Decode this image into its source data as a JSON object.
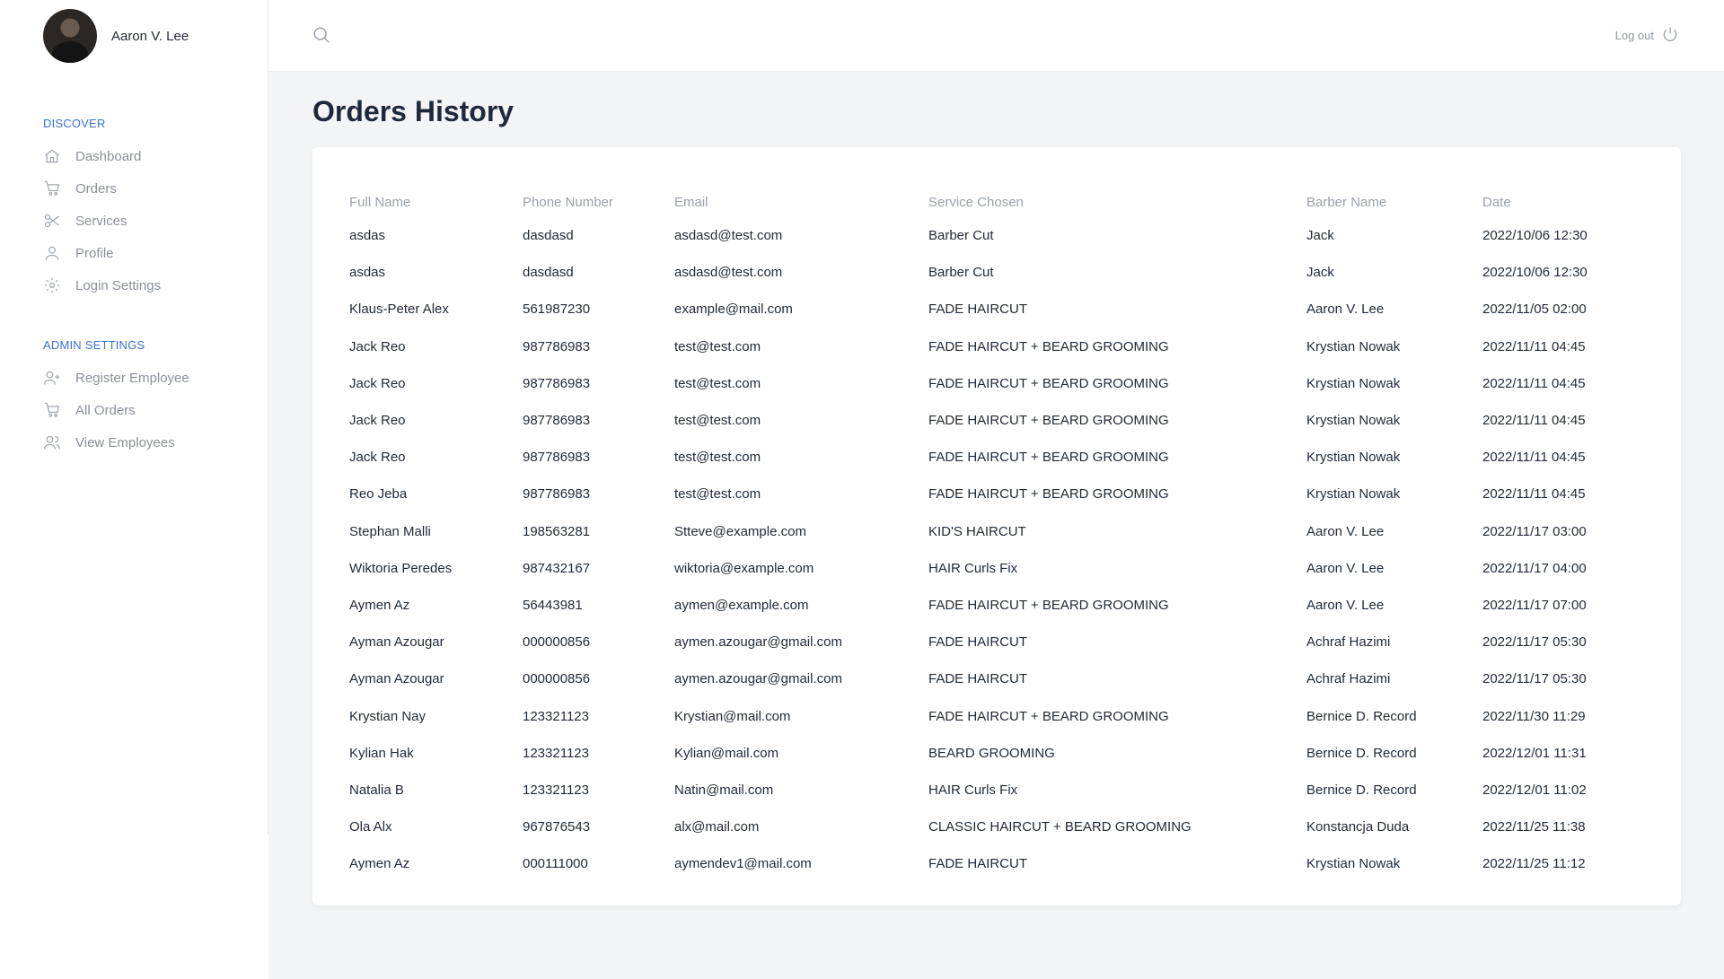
{
  "user": {
    "name": "Aaron V. Lee"
  },
  "sidebar": {
    "discover_title": "DISCOVER",
    "discover_items": [
      {
        "label": "Dashboard",
        "icon": "home-icon"
      },
      {
        "label": "Orders",
        "icon": "cart-icon"
      },
      {
        "label": "Services",
        "icon": "scissors-icon"
      },
      {
        "label": "Profile",
        "icon": "user-icon"
      },
      {
        "label": "Login Settings",
        "icon": "gear-icon"
      }
    ],
    "admin_title": "ADMIN SETTINGS",
    "admin_items": [
      {
        "label": "Register Employee",
        "icon": "user-plus-icon"
      },
      {
        "label": "All Orders",
        "icon": "cart-icon"
      },
      {
        "label": "View Employees",
        "icon": "users-icon"
      }
    ]
  },
  "topbar": {
    "logout_label": "Log out"
  },
  "page": {
    "title": "Orders History"
  },
  "table": {
    "columns": [
      "Full Name",
      "Phone Number",
      "Email",
      "Service Chosen",
      "Barber Name",
      "Date"
    ],
    "rows": [
      [
        "asdas",
        "dasdasd",
        "asdasd@test.com",
        "Barber Cut",
        "Jack",
        "2022/10/06 12:30"
      ],
      [
        "asdas",
        "dasdasd",
        "asdasd@test.com",
        "Barber Cut",
        "Jack",
        "2022/10/06 12:30"
      ],
      [
        "Klaus-Peter Alex",
        "561987230",
        "example@mail.com",
        "FADE HAIRCUT",
        "Aaron V. Lee",
        "2022/11/05 02:00"
      ],
      [
        "Jack Reo",
        "987786983",
        "test@test.com",
        "FADE HAIRCUT + BEARD GROOMING",
        "Krystian Nowak",
        "2022/11/11 04:45"
      ],
      [
        "Jack Reo",
        "987786983",
        "test@test.com",
        "FADE HAIRCUT + BEARD GROOMING",
        "Krystian Nowak",
        "2022/11/11 04:45"
      ],
      [
        "Jack Reo",
        "987786983",
        "test@test.com",
        "FADE HAIRCUT + BEARD GROOMING",
        "Krystian Nowak",
        "2022/11/11 04:45"
      ],
      [
        "Jack Reo",
        "987786983",
        "test@test.com",
        "FADE HAIRCUT + BEARD GROOMING",
        "Krystian Nowak",
        "2022/11/11 04:45"
      ],
      [
        "Reo Jeba",
        "987786983",
        "test@test.com",
        "FADE HAIRCUT + BEARD GROOMING",
        "Krystian Nowak",
        "2022/11/11 04:45"
      ],
      [
        "Stephan Malli",
        "198563281",
        "Stteve@example.com",
        "KID'S HAIRCUT",
        "Aaron V. Lee",
        "2022/11/17 03:00"
      ],
      [
        "Wiktoria Peredes",
        "987432167",
        "wiktoria@example.com",
        "HAIR Curls Fix",
        "Aaron V. Lee",
        "2022/11/17 04:00"
      ],
      [
        "Aymen Az",
        "56443981",
        "aymen@example.com",
        "FADE HAIRCUT + BEARD GROOMING",
        "Aaron V. Lee",
        "2022/11/17 07:00"
      ],
      [
        "Ayman Azougar",
        "000000856",
        "aymen.azougar@gmail.com",
        "FADE HAIRCUT",
        "Achraf Hazimi",
        "2022/11/17 05:30"
      ],
      [
        "Ayman Azougar",
        "000000856",
        "aymen.azougar@gmail.com",
        "FADE HAIRCUT",
        "Achraf Hazimi",
        "2022/11/17 05:30"
      ],
      [
        "Krystian Nay",
        "123321123",
        "Krystian@mail.com",
        "FADE HAIRCUT + BEARD GROOMING",
        "Bernice D. Record",
        "2022/11/30 11:29"
      ],
      [
        "Kylian Hak",
        "123321123",
        "Kylian@mail.com",
        "BEARD GROOMING",
        "Bernice D. Record",
        "2022/12/01 11:31"
      ],
      [
        "Natalia B",
        "123321123",
        "Natin@mail.com",
        "HAIR Curls Fix",
        "Bernice D. Record",
        "2022/12/01 11:02"
      ],
      [
        "Ola Alx",
        "967876543",
        "alx@mail.com",
        "CLASSIC HAIRCUT + BEARD GROOMING",
        "Konstancja Duda",
        "2022/11/25 11:38"
      ],
      [
        "Aymen Az",
        "000111000",
        "aymendev1@mail.com",
        "FADE HAIRCUT",
        "Krystian Nowak",
        "2022/11/25 11:12"
      ]
    ]
  },
  "colors": {
    "accent": "#3a6fd8",
    "background": "#f3f4f6",
    "card": "#ffffff"
  }
}
